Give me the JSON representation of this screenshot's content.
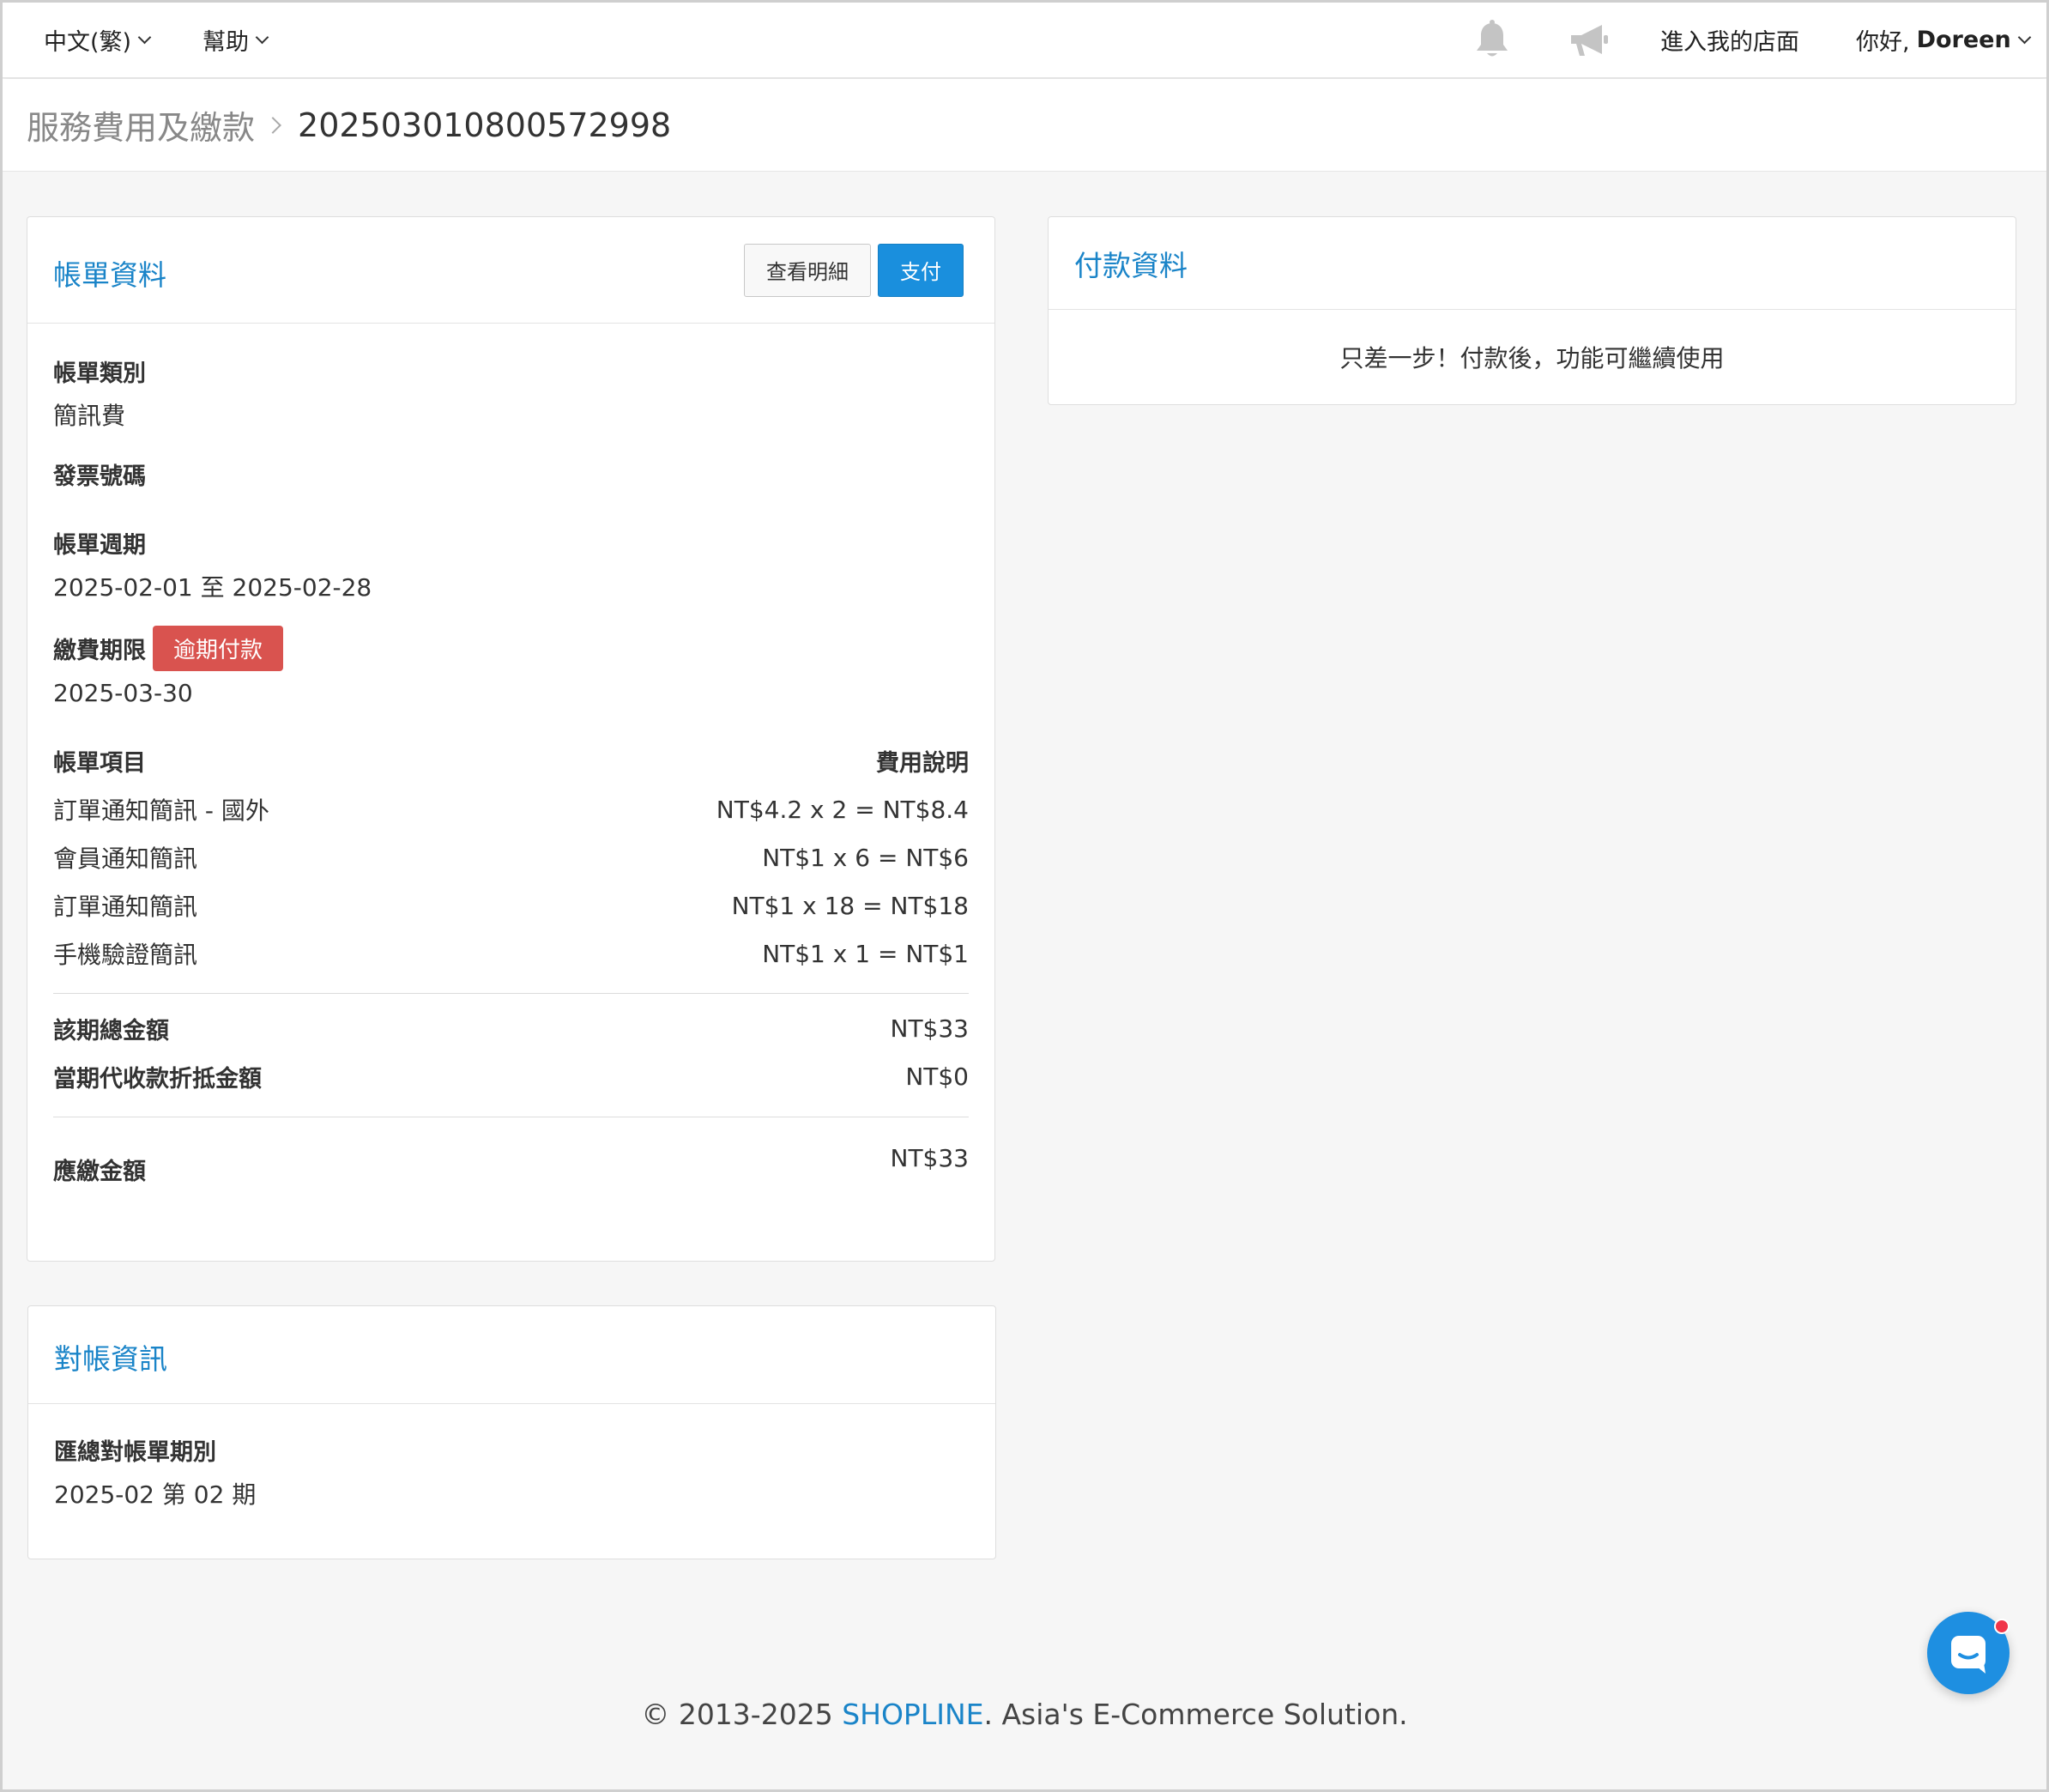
{
  "topbar": {
    "language": "中文(繁)",
    "help": "幫助",
    "store_link": "進入我的店面",
    "greeting": "你好,",
    "username": "Doreen"
  },
  "breadcrumb": {
    "parent": "服務費用及繳款",
    "current": "202503010800572998"
  },
  "bill": {
    "title": "帳單資料",
    "view_details": "查看明細",
    "pay": "支付",
    "type_label": "帳單類別",
    "type_value": "簡訊費",
    "invoice_label": "發票號碼",
    "period_label": "帳單週期",
    "period_value": "2025-02-01 至 2025-02-28",
    "due_label": "繳費期限",
    "due_badge": "逾期付款",
    "due_value": "2025-03-30",
    "items_header": "帳單項目",
    "fee_header": "費用說明",
    "items": [
      {
        "name": "訂單通知簡訊 - 國外",
        "fee": "NT$4.2 x 2 = NT$8.4"
      },
      {
        "name": "會員通知簡訊",
        "fee": "NT$1 x 6 = NT$6"
      },
      {
        "name": "訂單通知簡訊",
        "fee": "NT$1 x 18 = NT$18"
      },
      {
        "name": "手機驗證簡訊",
        "fee": "NT$1 x 1 = NT$1"
      }
    ],
    "total_label": "該期總金額",
    "total_value": "NT$33",
    "offset_label": "當期代收款折抵金額",
    "offset_value": "NT$0",
    "due_amount_label": "應繳金額",
    "due_amount_value": "NT$33"
  },
  "payment": {
    "title": "付款資料",
    "message": "只差一步！付款後，功能可繼續使用"
  },
  "reconciliation": {
    "title": "對帳資訊",
    "period_label": "匯總對帳單期別",
    "period_value": "2025-02 第 02 期"
  },
  "footer": {
    "prefix": "© 2013-2025 ",
    "brand": "SHOPLINE",
    "suffix": ". Asia's E-Commerce Solution."
  },
  "colors": {
    "accent": "#1a84c8",
    "primary_button": "#1a8fdd",
    "overdue_badge": "#d9534f",
    "chat": "#1e8fe1"
  },
  "icons": [
    "chevron-down-icon",
    "bell-icon",
    "megaphone-icon",
    "chevron-right-icon",
    "chat-icon"
  ]
}
